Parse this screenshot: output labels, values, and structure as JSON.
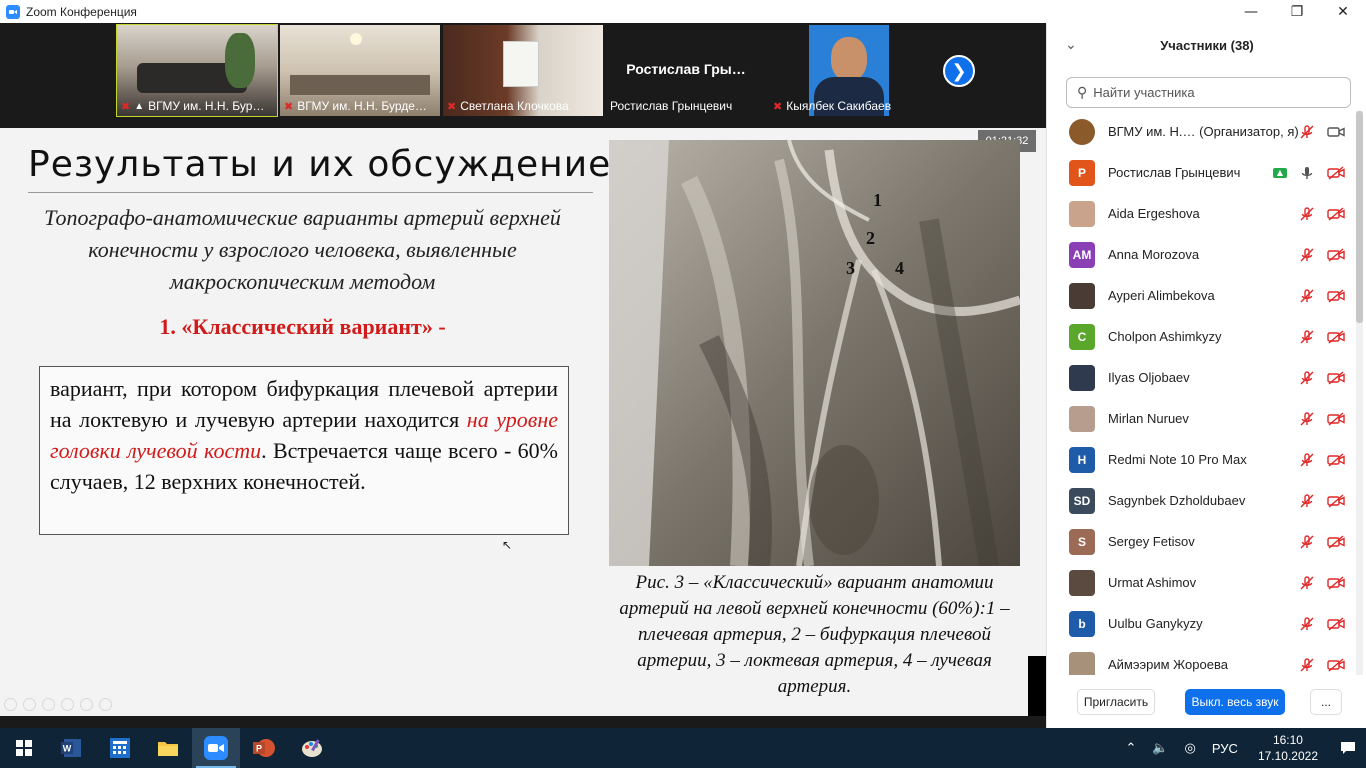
{
  "window": {
    "title": "Zoom Конференция"
  },
  "strip": {
    "tiles": [
      {
        "name": "ВГМУ им. Н.Н. Бур…"
      },
      {
        "name": "ВГМУ им. Н.Н. Бурде…"
      },
      {
        "name": "Светлана Клочкова"
      },
      {
        "name": "Ростислав Грынцевич",
        "big_label": "Ростислав Гры…"
      },
      {
        "name": "Кыялбек Сакибаев"
      }
    ]
  },
  "share": {
    "timer": "01:21:32",
    "title": "Результаты и их обсуждение",
    "subtitle": "Топографо-анатомические варианты артерий верхней конечности у взрослого человека, выявленные макроскопическим методом",
    "variant_heading": "1. «Классический вариант» -",
    "description_before": "вариант, при котором бифуркация плечевой артерии на локтевую и лучевую артерии находится ",
    "description_highlight": "на уровне головки лучевой кости",
    "description_after": ". Встречается чаще всего - 60% случаев, 12 верхних конечностей.",
    "photo_labels": [
      "1",
      "2",
      "3",
      "4"
    ],
    "caption": "Рис. 3 – «Классический» вариант анатомии артерий на левой верхней конечности (60%):1 – плечевая артерия, 2 – бифуркация плечевой артерии, 3 – локтевая артерия, 4 – лучевая артерия."
  },
  "panel": {
    "title": "Участники (38)",
    "search_placeholder": "Найти участника",
    "participants": [
      {
        "name": "ВГМУ им. Н.… (Организатор, я)",
        "avatar_text": "",
        "avatar_color": "#8a5a2b",
        "mic": "off-host",
        "cam": "on"
      },
      {
        "name": "Ростислав Грынцевич",
        "avatar_text": "Р",
        "avatar_color": "#e2551a",
        "mic": "on",
        "cam": "off"
      },
      {
        "name": "Aida Ergeshova",
        "avatar_text": "",
        "avatar_color": "#c9a38c",
        "mic": "off",
        "cam": "off"
      },
      {
        "name": "Anna Morozova",
        "avatar_text": "AM",
        "avatar_color": "#8b3fb5",
        "mic": "off",
        "cam": "off"
      },
      {
        "name": "Ayperi Alimbekova",
        "avatar_text": "",
        "avatar_color": "#4a3b35",
        "mic": "off",
        "cam": "off"
      },
      {
        "name": "Cholpon Ashimkyzy",
        "avatar_text": "C",
        "avatar_color": "#5aa72b",
        "mic": "off",
        "cam": "off"
      },
      {
        "name": "Ilyas Oljobaev",
        "avatar_text": "",
        "avatar_color": "#2f3a4f",
        "mic": "off",
        "cam": "off"
      },
      {
        "name": "Mirlan Nuruev",
        "avatar_text": "",
        "avatar_color": "#b79d8e",
        "mic": "off",
        "cam": "off"
      },
      {
        "name": "Redmi Note 10 Pro Max",
        "avatar_text": "H",
        "avatar_color": "#1e5ba8",
        "mic": "off",
        "cam": "off"
      },
      {
        "name": "Sagynbek Dzholdubaev",
        "avatar_text": "SD",
        "avatar_color": "#3b4a5c",
        "mic": "off",
        "cam": "off"
      },
      {
        "name": "Sergey Fetisov",
        "avatar_text": "S",
        "avatar_color": "#9b6b55",
        "mic": "off",
        "cam": "off"
      },
      {
        "name": "Urmat Ashimov",
        "avatar_text": "",
        "avatar_color": "#5a4a3f",
        "mic": "off",
        "cam": "off"
      },
      {
        "name": "Uulbu Ganykyzy",
        "avatar_text": "b",
        "avatar_color": "#1e5ba8",
        "mic": "off",
        "cam": "off"
      },
      {
        "name": "Аймээрим Жороева",
        "avatar_text": "",
        "avatar_color": "#a8917b",
        "mic": "off",
        "cam": "off"
      }
    ],
    "invite_label": "Пригласить",
    "mute_all_label": "Выкл. весь звук",
    "more_label": "..."
  },
  "taskbar": {
    "apps": [
      "windows-start",
      "word",
      "calculator-app",
      "file-explorer",
      "zoom",
      "powerpoint",
      "paint"
    ],
    "language": "РУС",
    "time": "16:10",
    "date": "17.10.2022"
  },
  "colors": {
    "zoom_blue": "#0e71eb",
    "accent_red": "#d11a1a",
    "mute_red": "#e02828"
  }
}
